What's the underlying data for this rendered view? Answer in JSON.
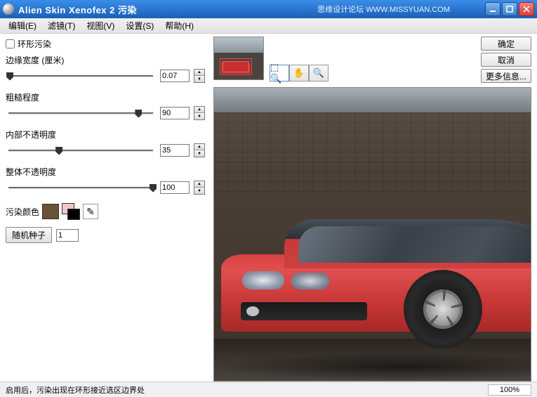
{
  "window": {
    "title": "Alien Skin Xenofex 2 污染",
    "watermark": "思缘设计论坛 WWW.MISSYUAN.COM"
  },
  "menu": {
    "edit": "编辑(E)",
    "filter": "滤镜(T)",
    "view": "视图(V)",
    "settings": "设置(S)",
    "help": "帮助(H)"
  },
  "controls": {
    "ring_stain": "环形污染",
    "edge_width": {
      "label": "边缘宽度 (厘米)",
      "value": "0.07"
    },
    "roughness": {
      "label": "粗糙程度",
      "value": "90"
    },
    "inner_opacity": {
      "label": "内部不透明度",
      "value": "35"
    },
    "overall_opacity": {
      "label": "整体不透明度",
      "value": "100"
    },
    "stain_color_label": "污染颜色",
    "stain_color": "#6a5238",
    "random_seed_label": "随机种子",
    "random_seed_value": "1"
  },
  "actions": {
    "ok": "确定",
    "cancel": "取消",
    "more": "更多信息..."
  },
  "status": {
    "hint": "启用后，污染出现在环形接近选区边界处",
    "zoom": "100%"
  }
}
